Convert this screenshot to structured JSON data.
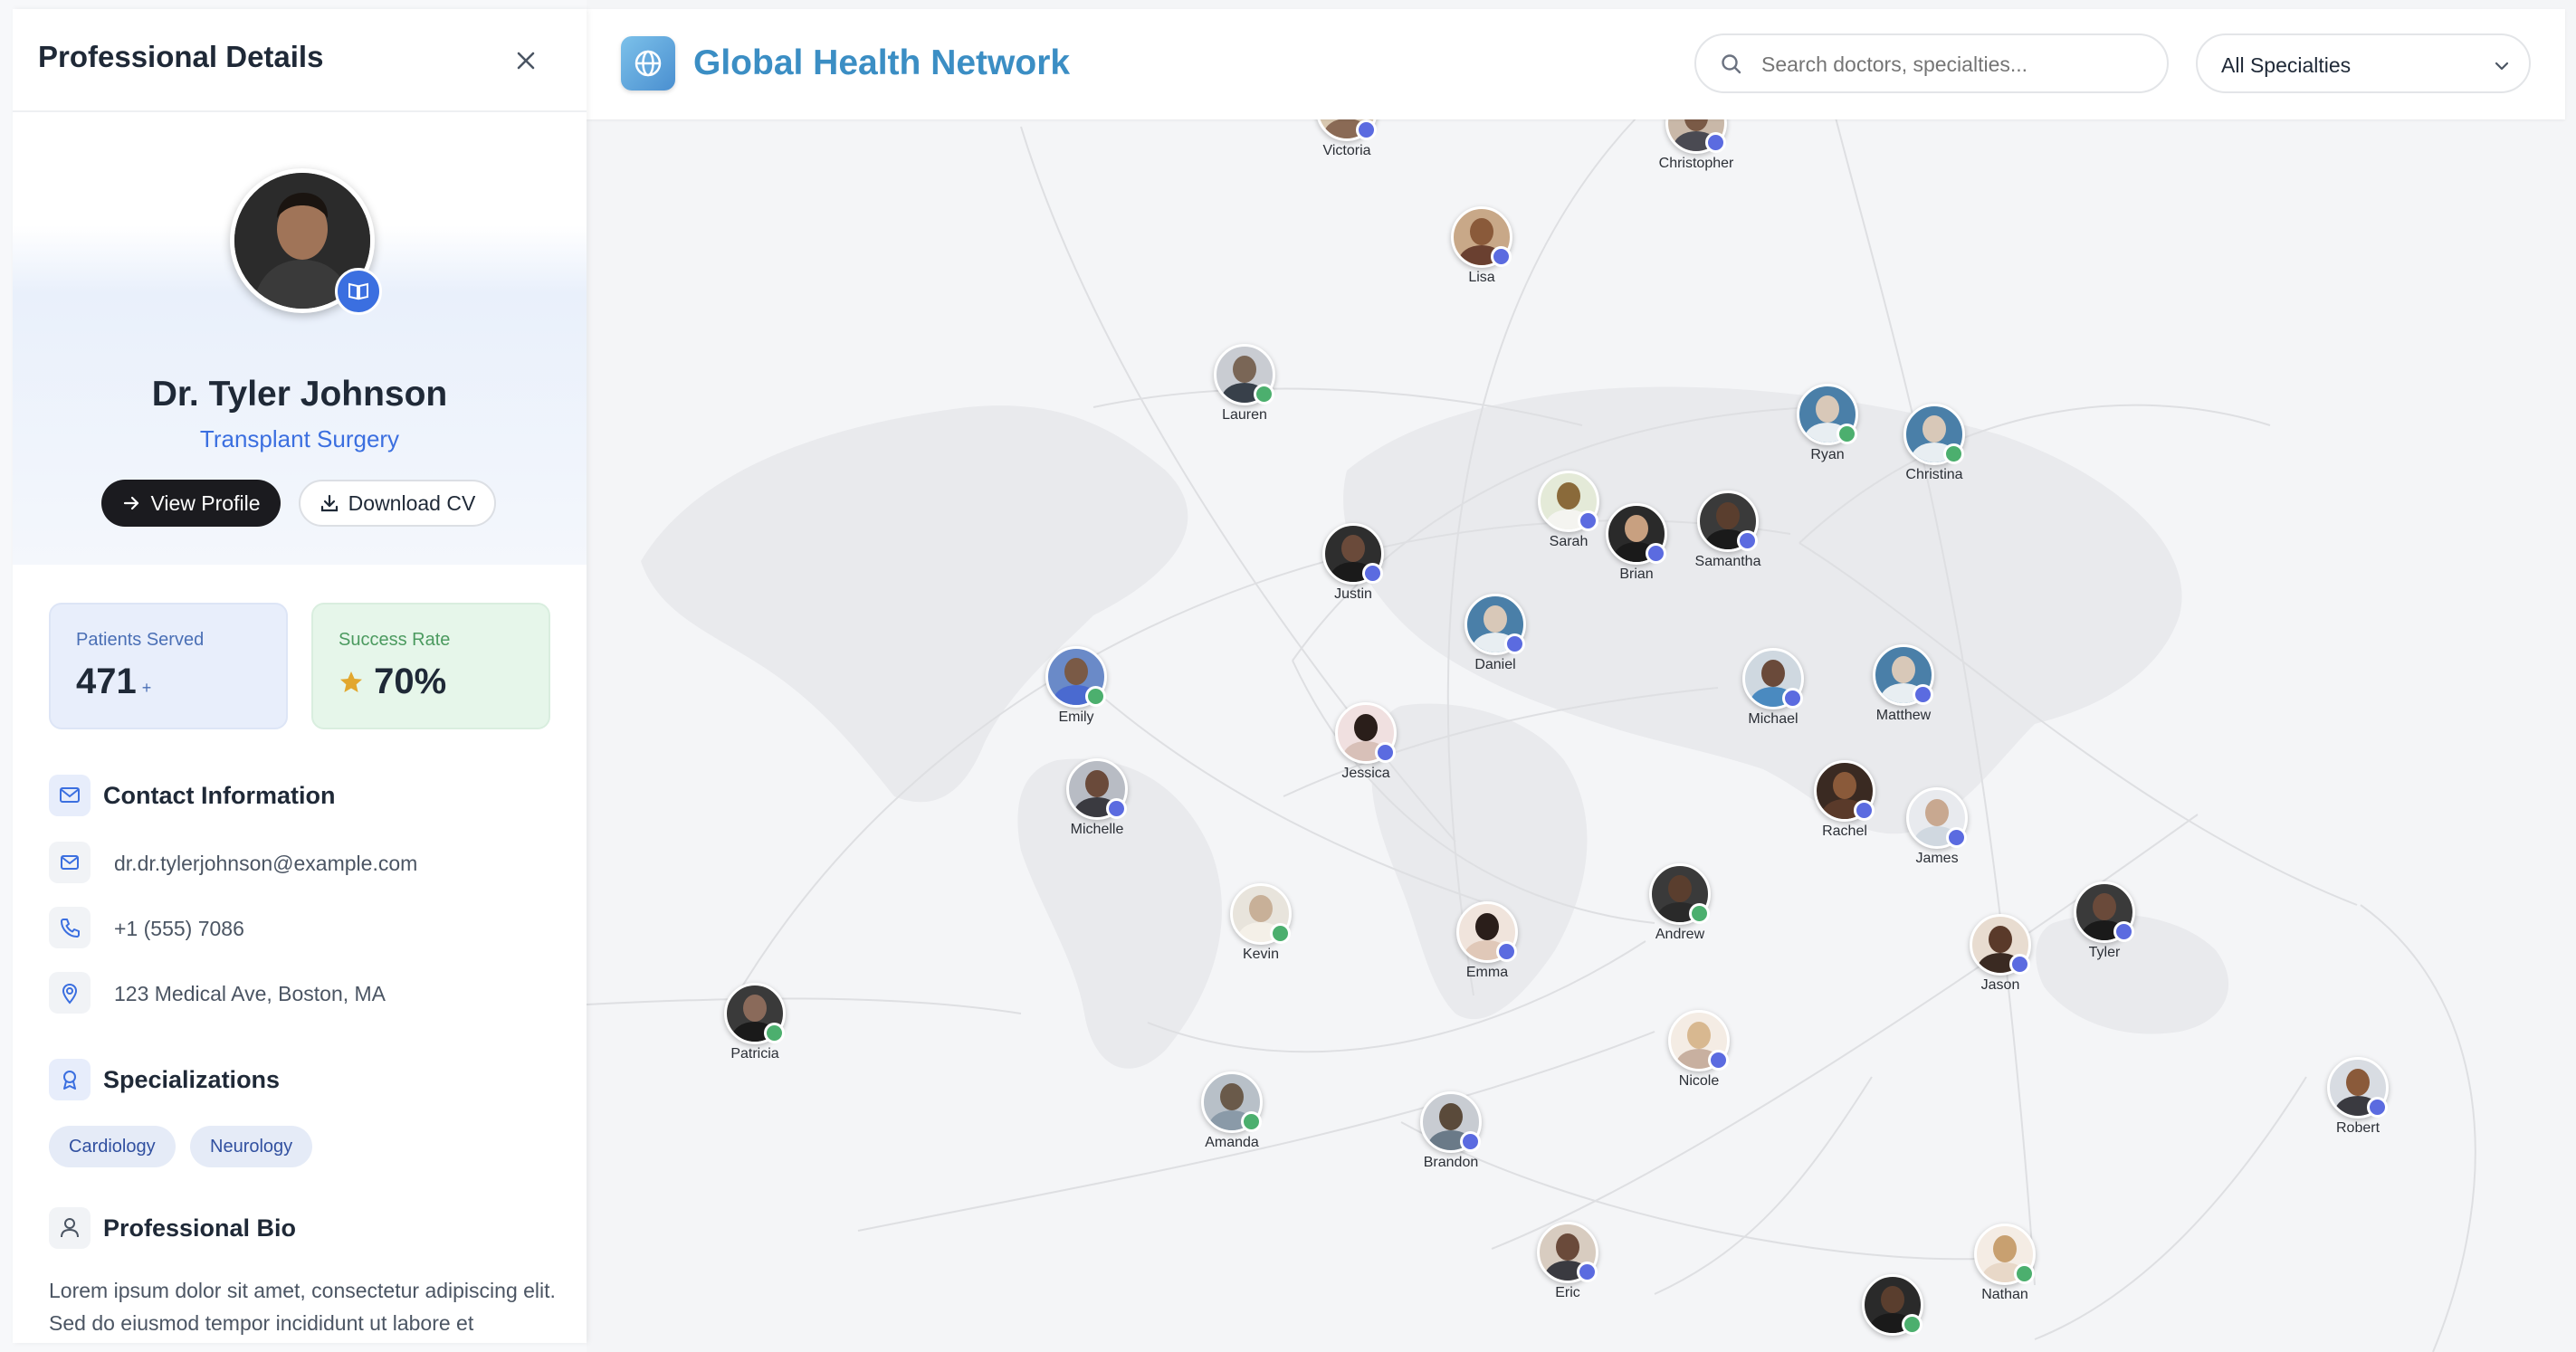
{
  "header": {
    "brand_title": "Global Health Network",
    "search_placeholder": "Search doctors, specialties...",
    "specialty_filter_value": "All Specialties"
  },
  "sidebar": {
    "title": "Professional Details",
    "doctor_name": "Dr. Tyler Johnson",
    "doctor_specialty": "Transplant Surgery",
    "view_profile_label": "View Profile",
    "download_cv_label": "Download CV",
    "stats": {
      "patients_label": "Patients Served",
      "patients_value": "471",
      "patients_suffix": "+",
      "success_label": "Success Rate",
      "success_value": "70%"
    },
    "contact": {
      "heading": "Contact Information",
      "email": "dr.dr.tylerjohnson@example.com",
      "phone": "+1 (555) 7086",
      "address": "123 Medical Ave, Boston, MA"
    },
    "specializations": {
      "heading": "Specializations",
      "tags": [
        "Cardiology",
        "Neurology"
      ]
    },
    "bio": {
      "heading": "Professional Bio",
      "text": "Lorem ipsum dolor sit amet, consectetur adipiscing elit. Sed do eiusmod tempor incididunt ut labore et"
    }
  },
  "colors": {
    "accent": "#3b6fe0",
    "status_available": "#4caf6e",
    "status_busy": "#5b6be0",
    "brand_gradient_start": "#7cc1ea",
    "brand_gradient_end": "#2f6fa6"
  },
  "doctors": [
    {
      "name": "Victoria",
      "status": "busy"
    },
    {
      "name": "Christopher",
      "status": "busy"
    },
    {
      "name": "Lisa",
      "status": "busy"
    },
    {
      "name": "Lauren",
      "status": "available"
    },
    {
      "name": "Ryan",
      "status": "available"
    },
    {
      "name": "Christina",
      "status": "available"
    },
    {
      "name": "Sarah",
      "status": "busy"
    },
    {
      "name": "Brian",
      "status": "busy"
    },
    {
      "name": "Samantha",
      "status": "busy"
    },
    {
      "name": "Justin",
      "status": "busy"
    },
    {
      "name": "Daniel",
      "status": "busy"
    },
    {
      "name": "Emily",
      "status": "available"
    },
    {
      "name": "Michael",
      "status": "busy"
    },
    {
      "name": "Matthew",
      "status": "busy"
    },
    {
      "name": "Jessica",
      "status": "busy"
    },
    {
      "name": "Michelle",
      "status": "busy"
    },
    {
      "name": "Rachel",
      "status": "busy"
    },
    {
      "name": "James",
      "status": "busy"
    },
    {
      "name": "Kevin",
      "status": "available"
    },
    {
      "name": "Andrew",
      "status": "available"
    },
    {
      "name": "Emma",
      "status": "busy"
    },
    {
      "name": "Tyler",
      "status": "busy"
    },
    {
      "name": "Jason",
      "status": "busy"
    },
    {
      "name": "Patricia",
      "status": "available"
    },
    {
      "name": "Nicole",
      "status": "busy"
    },
    {
      "name": "Robert",
      "status": "busy"
    },
    {
      "name": "Amanda",
      "status": "available"
    },
    {
      "name": "Brandon",
      "status": "busy"
    },
    {
      "name": "Eric",
      "status": "busy"
    },
    {
      "name": "Nathan",
      "status": "available"
    },
    {
      "name": "",
      "status": "available"
    }
  ]
}
